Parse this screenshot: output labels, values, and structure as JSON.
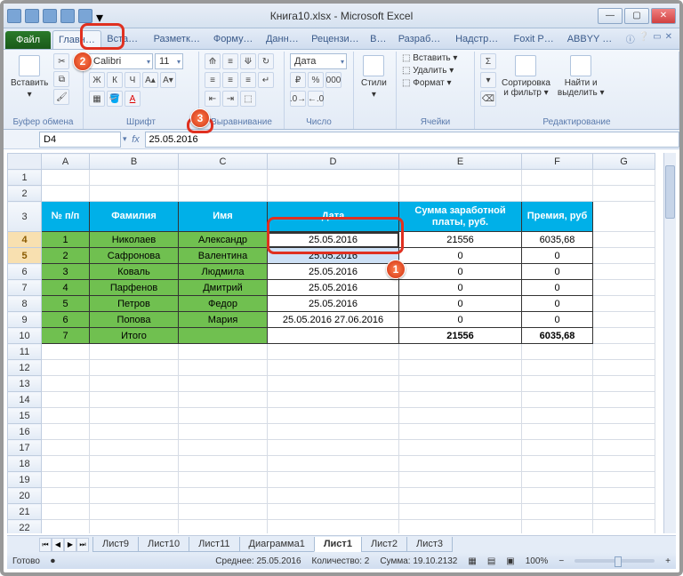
{
  "window": {
    "title": "Книга10.xlsx - Microsoft Excel"
  },
  "qat_icons": [
    "excel",
    "save",
    "undo",
    "redo",
    "refresh",
    "dropdown"
  ],
  "tabs": {
    "file": "Файл",
    "items": [
      "Главная",
      "Вставка",
      "Разметка с",
      "Формулы",
      "Данные",
      "Рецензиро",
      "Вид",
      "Разработч",
      "Надстройк",
      "Foxit PDF",
      "ABBYY PD"
    ],
    "active_index": 0,
    "help_glyphs": [
      "ⓘ",
      "❔",
      "▭",
      "✕"
    ]
  },
  "ribbon": {
    "clipboard": {
      "paste": "Вставить",
      "label": "Буфер обмена"
    },
    "font": {
      "name": "Calibri",
      "size": "11",
      "label": "Шрифт",
      "bold": "Ж",
      "italic": "К",
      "under": "Ч"
    },
    "align": {
      "label": "Выравнивание"
    },
    "number": {
      "format": "Дата",
      "label": "Число"
    },
    "styles": {
      "btn": "Стили",
      "label": ""
    },
    "cells": {
      "insert": "Вставить ▾",
      "delete": "Удалить ▾",
      "format": "Формат ▾",
      "label": "Ячейки"
    },
    "editing": {
      "sort": "Сортировка\nи фильтр ▾",
      "find": "Найти и\nвыделить ▾",
      "label": "Редактирование"
    }
  },
  "namebox": "D4",
  "formula": "25.05.2016",
  "colHeaders": [
    "A",
    "B",
    "C",
    "D",
    "E",
    "F",
    "G"
  ],
  "rows": [
    {
      "n": "1",
      "cells": [
        "",
        "",
        "",
        "",
        "",
        "",
        ""
      ]
    },
    {
      "n": "2",
      "cells": [
        "",
        "",
        "",
        "",
        "",
        "",
        ""
      ]
    },
    {
      "n": "3",
      "hdr": true,
      "cells": [
        "№ п/п",
        "Фамилия",
        "Имя",
        "Дата",
        "Сумма заработной платы, руб.",
        "Премия, руб",
        ""
      ]
    },
    {
      "n": "4",
      "sel": true,
      "g": true,
      "cells": [
        "1",
        "Николаев",
        "Александр",
        "25.05.2016",
        "21556",
        "6035,68",
        ""
      ]
    },
    {
      "n": "5",
      "sel": true,
      "g": true,
      "cells": [
        "2",
        "Сафронова",
        "Валентина",
        "25.05.2016",
        "0",
        "0",
        ""
      ]
    },
    {
      "n": "6",
      "g": true,
      "cells": [
        "3",
        "Коваль",
        "Людмила",
        "25.05.2016",
        "0",
        "0",
        ""
      ]
    },
    {
      "n": "7",
      "g": true,
      "cells": [
        "4",
        "Парфенов",
        "Дмитрий",
        "25.05.2016",
        "0",
        "0",
        ""
      ]
    },
    {
      "n": "8",
      "g": true,
      "cells": [
        "5",
        "Петров",
        "Федор",
        "25.05.2016",
        "0",
        "0",
        ""
      ]
    },
    {
      "n": "9",
      "g": true,
      "cells": [
        "6",
        "Попова",
        "Мария",
        "25.05.2016 27.06.2016",
        "0",
        "0",
        ""
      ]
    },
    {
      "n": "10",
      "g": true,
      "cells": [
        "7",
        "Итого",
        "",
        "",
        "21556",
        "6035,68",
        ""
      ]
    },
    {
      "n": "11",
      "cells": [
        "",
        "",
        "",
        "",
        "",
        "",
        ""
      ]
    },
    {
      "n": "12",
      "cells": [
        "",
        "",
        "",
        "",
        "",
        "",
        ""
      ]
    },
    {
      "n": "13",
      "cells": [
        "",
        "",
        "",
        "",
        "",
        "",
        ""
      ]
    },
    {
      "n": "14",
      "cells": [
        "",
        "",
        "",
        "",
        "",
        "",
        ""
      ]
    },
    {
      "n": "15",
      "cells": [
        "",
        "",
        "",
        "",
        "",
        "",
        ""
      ]
    },
    {
      "n": "16",
      "cells": [
        "",
        "",
        "",
        "",
        "",
        "",
        ""
      ]
    },
    {
      "n": "17",
      "cells": [
        "",
        "",
        "",
        "",
        "",
        "",
        ""
      ]
    },
    {
      "n": "18",
      "cells": [
        "",
        "",
        "",
        "",
        "",
        "",
        ""
      ]
    },
    {
      "n": "19",
      "cells": [
        "",
        "",
        "",
        "",
        "",
        "",
        ""
      ]
    },
    {
      "n": "20",
      "cells": [
        "",
        "",
        "",
        "",
        "",
        "",
        ""
      ]
    },
    {
      "n": "21",
      "cells": [
        "",
        "",
        "",
        "",
        "",
        "",
        ""
      ]
    },
    {
      "n": "22",
      "cells": [
        "",
        "",
        "",
        "",
        "",
        "",
        ""
      ]
    }
  ],
  "sheetTabs": {
    "items": [
      "Лист9",
      "Лист10",
      "Лист11",
      "Диаграмма1",
      "Лист1",
      "Лист2",
      "Лист3"
    ],
    "active_index": 4
  },
  "status": {
    "ready": "Готово",
    "avg": "Среднее: 25.05.2016",
    "count": "Количество: 2",
    "sum": "Сумма: 19.10.2132",
    "zoom": "100%"
  },
  "callouts": {
    "c1": "1",
    "c2": "2",
    "c3": "3"
  }
}
